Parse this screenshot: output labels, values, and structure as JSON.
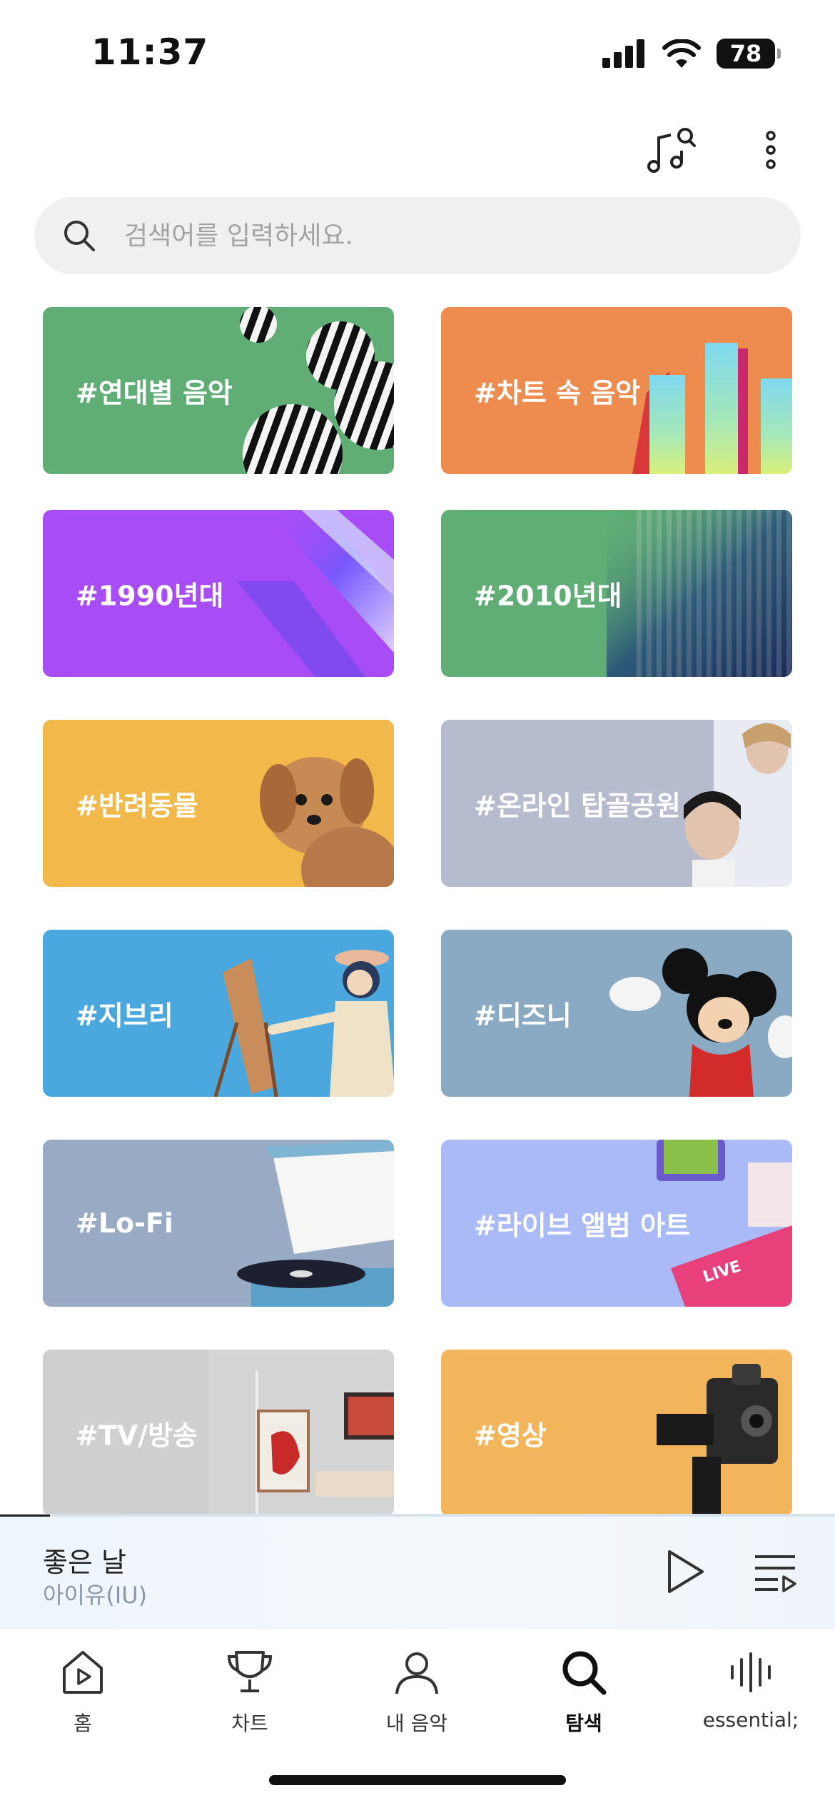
{
  "status_bar": {
    "time": "11:37",
    "battery": "78"
  },
  "search": {
    "placeholder": "검색어를 입력하세요."
  },
  "tiles": [
    {
      "label": "#연대별 음악",
      "color": "#60ad76"
    },
    {
      "label": "#차트 속 음악",
      "color": "#ee8b4f"
    },
    {
      "label": "#1990년대",
      "color": "#a84df5"
    },
    {
      "label": "#2010년대",
      "color": "#60ad76"
    },
    {
      "label": "#반려동물",
      "color": "#f2b84a"
    },
    {
      "label": "#온라인 탑골공원",
      "color": "#b6bccd"
    },
    {
      "label": "#지브리",
      "color": "#4aa8de"
    },
    {
      "label": "#디즈니",
      "color": "#8aaac4"
    },
    {
      "label": "#Lo-Fi",
      "color": "#98aac4"
    },
    {
      "label": "#라이브 앨범 아트",
      "color": "#aabaf6"
    },
    {
      "label": "#TV/방송",
      "color": "#cfcfcf"
    },
    {
      "label": "#영상",
      "color": "#f2b55b"
    }
  ],
  "player": {
    "title": "좋은 날",
    "artist": "아이유(IU)",
    "progress": 0.06
  },
  "tabs": [
    {
      "label": "홈",
      "icon": "home-play-icon"
    },
    {
      "label": "차트",
      "icon": "trophy-icon"
    },
    {
      "label": "내 음악",
      "icon": "person-icon"
    },
    {
      "label": "탐색",
      "icon": "search-icon",
      "active": true
    },
    {
      "label": "essential;",
      "icon": "soundwave-icon"
    }
  ]
}
